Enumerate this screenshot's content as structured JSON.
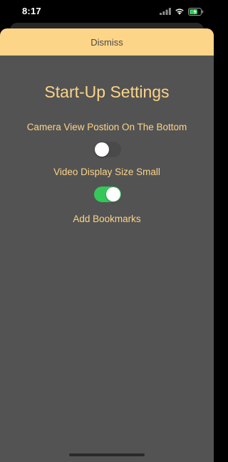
{
  "status_bar": {
    "time": "8:17"
  },
  "dismiss": {
    "label": "Dismiss"
  },
  "settings": {
    "title": "Start-Up Settings",
    "camera_position": {
      "label": "Camera View Postion On The Bottom",
      "enabled": false
    },
    "video_size": {
      "label": "Video Display Size Small",
      "enabled": true
    },
    "bookmarks_label": "Add Bookmarks"
  },
  "colors": {
    "accent": "#fcd489",
    "dismiss_bar": "#fdd588",
    "sheet_background": "#535353",
    "toggle_on": "#35c759"
  }
}
